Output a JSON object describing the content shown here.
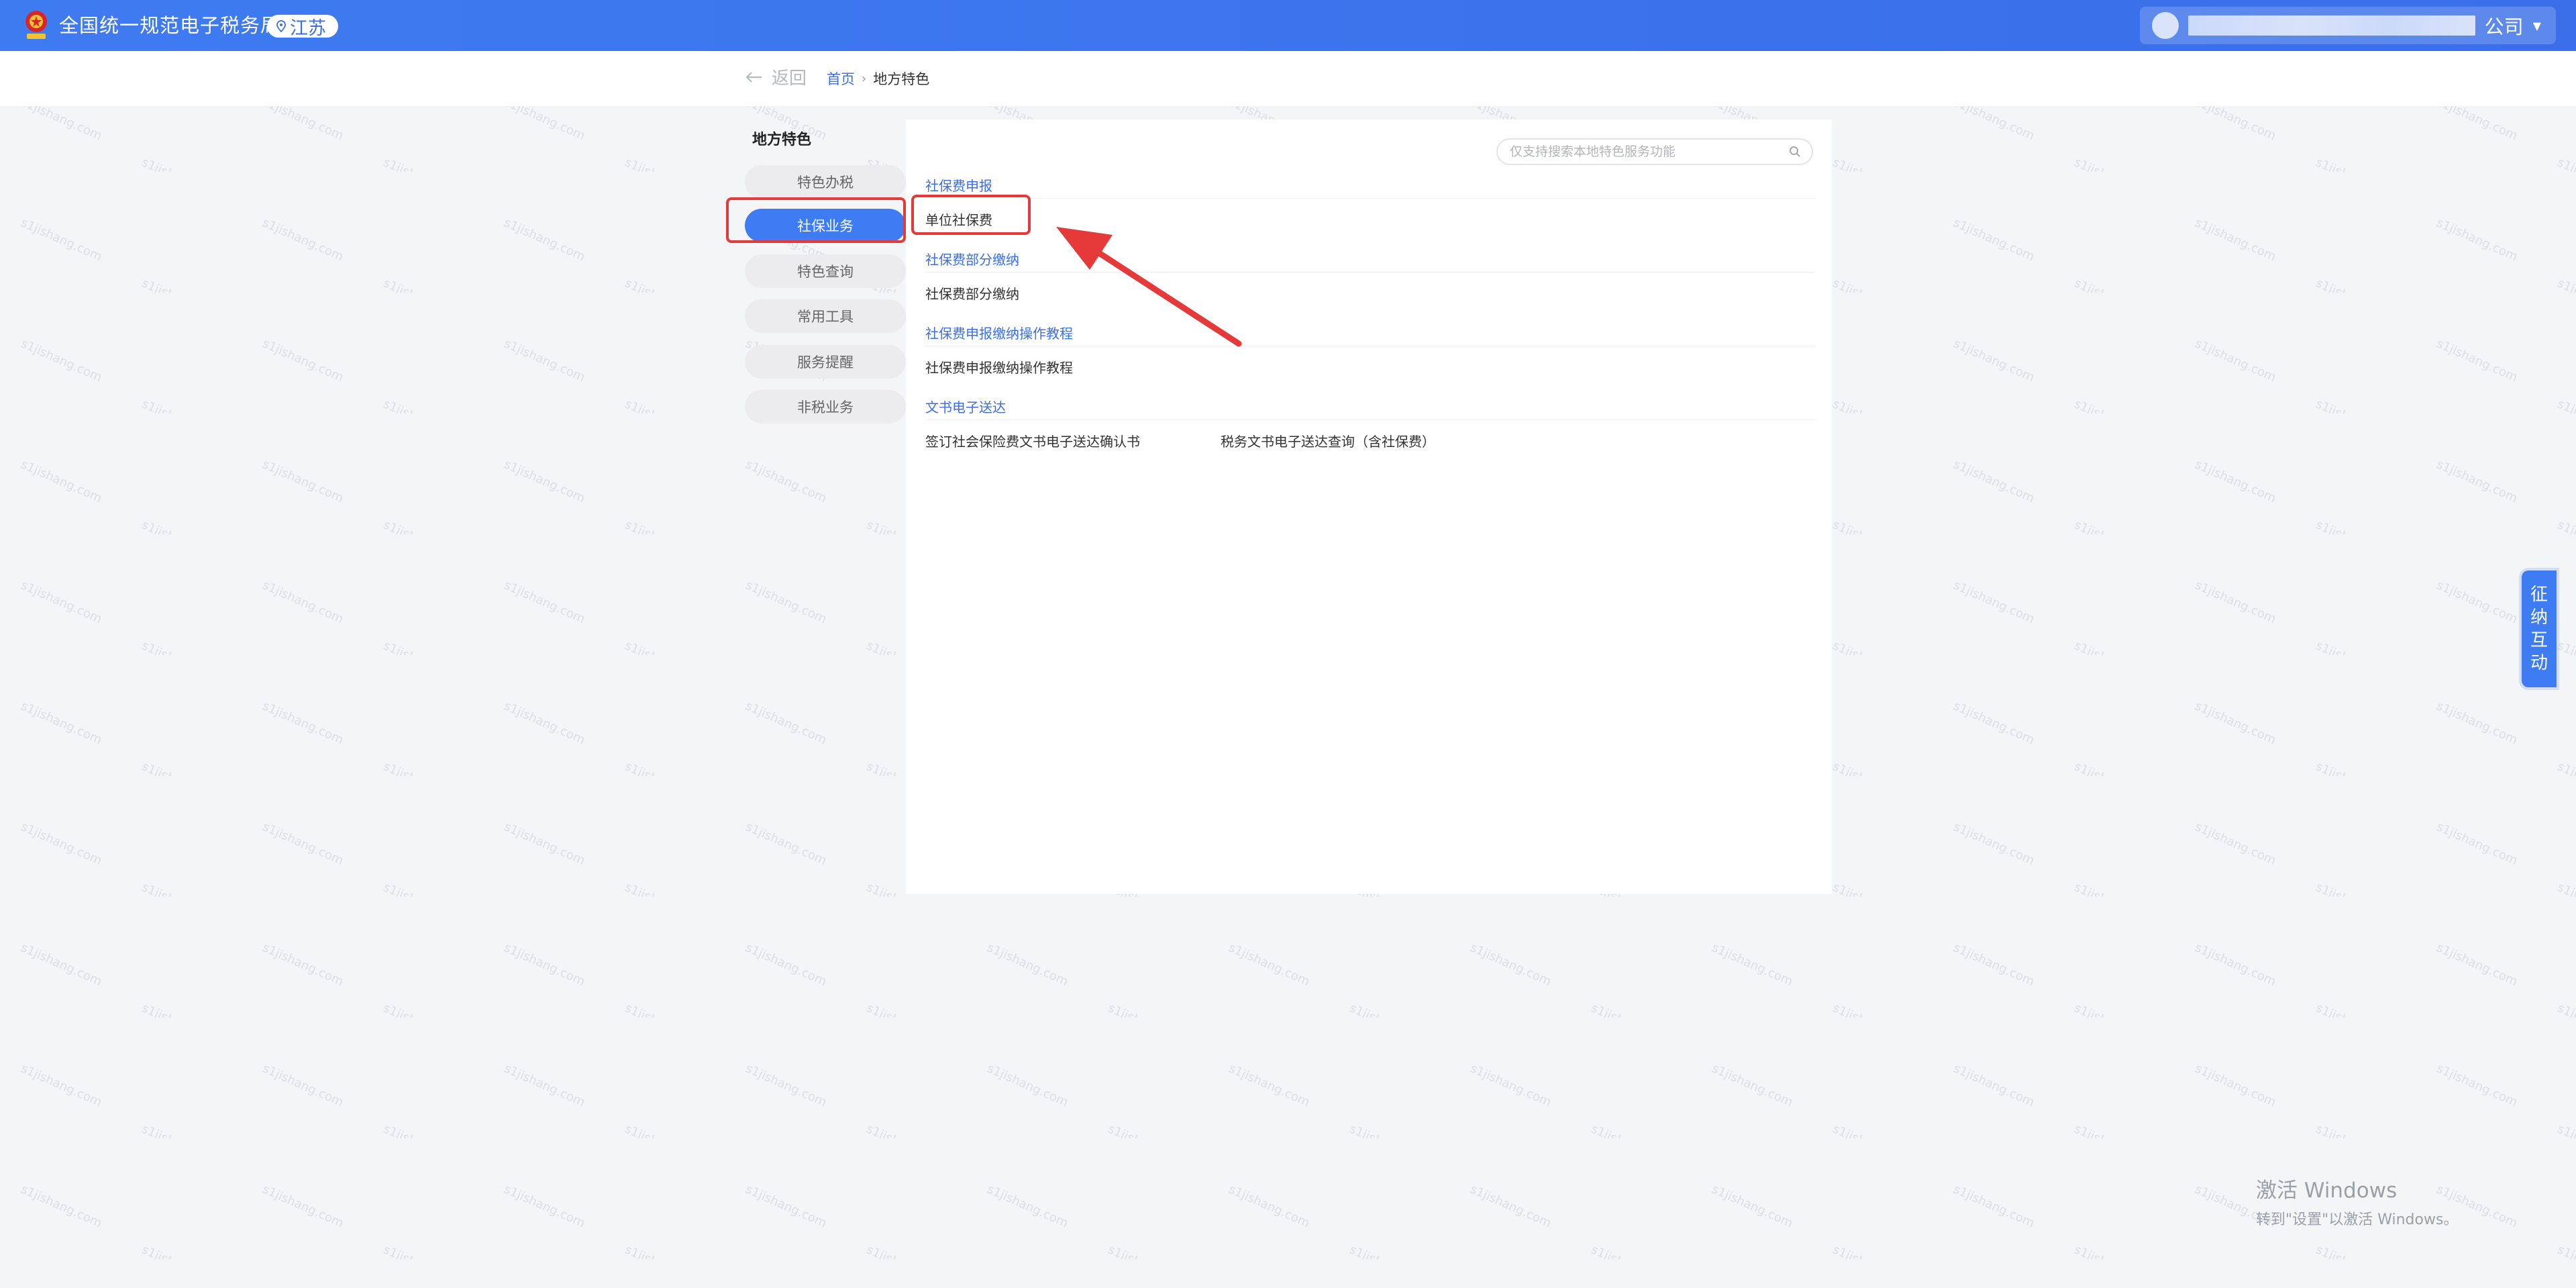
{
  "header": {
    "site_title": "全国统一规范电子税务局",
    "region": "江苏",
    "company_suffix": "公司"
  },
  "breadcrumb": {
    "back_label": "返回",
    "home": "首页",
    "current": "地方特色"
  },
  "menu": {
    "title": "地方特色",
    "items": [
      {
        "label": "特色办税",
        "active": false
      },
      {
        "label": "社保业务",
        "active": true
      },
      {
        "label": "特色查询",
        "active": false
      },
      {
        "label": "常用工具",
        "active": false
      },
      {
        "label": "服务提醒",
        "active": false
      },
      {
        "label": "非税业务",
        "active": false
      }
    ]
  },
  "search": {
    "placeholder": "仅支持搜索本地特色服务功能",
    "value": ""
  },
  "sections": [
    {
      "title": "社保费申报",
      "items": [
        "单位社保费"
      ]
    },
    {
      "title": "社保费部分缴纳",
      "items": [
        "社保费部分缴纳"
      ]
    },
    {
      "title": "社保费申报缴纳操作教程",
      "items": [
        "社保费申报缴纳操作教程"
      ]
    },
    {
      "title": "文书电子送达",
      "items": [
        "签订社会保险费文书电子送达确认书",
        "税务文书电子送达查询（含社保费）"
      ]
    }
  ],
  "float_button": {
    "label_chars": [
      "征",
      "纳",
      "互",
      "动"
    ]
  },
  "windows_activation": {
    "line1": "激活 Windows",
    "line2": "转到\"设置\"以激活 Windows。"
  },
  "watermark_text": "s1jishang.com",
  "colors": {
    "brand_blue": "#3a6fe9",
    "active_menu": "#3d7cf2",
    "annotation_red": "#e5393a"
  }
}
